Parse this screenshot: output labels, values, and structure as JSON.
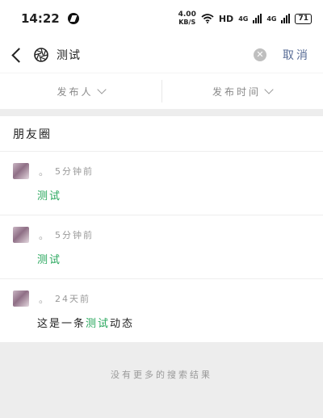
{
  "status_bar": {
    "time": "14:22",
    "net_speed_value": "4.00",
    "net_speed_unit": "KB/S",
    "hd_label": "HD",
    "net_type_1": "4G",
    "net_type_2": "4G",
    "battery": "71"
  },
  "search": {
    "query": "测试",
    "cancel_label": "取消"
  },
  "filters": [
    {
      "label": "发布人"
    },
    {
      "label": "发布时间"
    }
  ],
  "section_title": "朋友圈",
  "posts": [
    {
      "time_ago": "5分钟前",
      "content_before": "",
      "content_highlight": "测试",
      "content_after": ""
    },
    {
      "time_ago": "5分钟前",
      "content_before": "",
      "content_highlight": "测试",
      "content_after": ""
    },
    {
      "time_ago": "24天前",
      "content_before": "这是一条",
      "content_highlight": "测试",
      "content_after": "动态"
    }
  ],
  "footer_text": "没有更多的搜索结果",
  "colors": {
    "highlight": "#26a65b",
    "cancel_link": "#576b95",
    "background_gray": "#ededed"
  }
}
